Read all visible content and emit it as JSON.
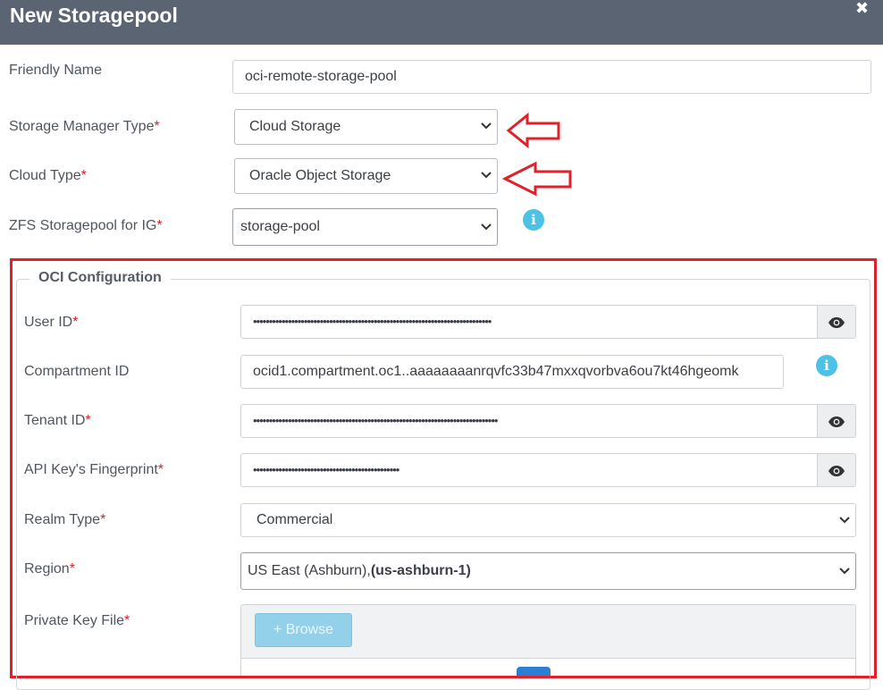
{
  "dialog": {
    "title": "New Storagepool",
    "close_icon": "✖"
  },
  "form": {
    "friendly_name": {
      "label": "Friendly Name",
      "value": "oci-remote-storage-pool"
    },
    "storage_manager_type": {
      "label": "Storage Manager Type",
      "required": "*",
      "value": "Cloud Storage"
    },
    "cloud_type": {
      "label": "Cloud Type",
      "required": "*",
      "value": "Oracle Object Storage"
    },
    "zfs_storagepool": {
      "label": "ZFS Storagepool for IG",
      "required": "*",
      "value": "storage-pool"
    }
  },
  "oci": {
    "legend": "OCI Configuration",
    "user_id": {
      "label": "User ID",
      "required": "*",
      "value": "•••••••••••••••••••••••••••••••••••••••••••••••••••••••••••••••••••••••••••"
    },
    "compartment_id": {
      "label": "Compartment ID",
      "value": "ocid1.compartment.oc1..aaaaaaaanrqvfc33b47mxxqvorbva6ou7kt46hgeomk"
    },
    "tenant_id": {
      "label": "Tenant ID",
      "required": "*",
      "value": "•••••••••••••••••••••••••••••••••••••••••••••••••••••••••••••••••••••••••••••"
    },
    "fingerprint": {
      "label": "API Key's Fingerprint",
      "required": "*",
      "value": "••••••••••••••••••••••••••••••••••••••••••••••"
    },
    "realm_type": {
      "label": "Realm Type",
      "required": "*",
      "value": "Commercial"
    },
    "region": {
      "label": "Region",
      "required": "*",
      "value_prefix": "US East (Ashburn),",
      "value_bold": "(us-ashburn-1)"
    },
    "private_key": {
      "label": "Private Key File",
      "required": "*",
      "browse_label": "Browse",
      "browse_icon": "+"
    }
  },
  "icons": {
    "info": "i",
    "eye": "eye-icon",
    "chevron": "chevron-down-icon"
  },
  "colors": {
    "header_bg": "#5b6472",
    "required": "#d2232a",
    "annotation_red": "#e0202a",
    "info_blue": "#4ec1e6",
    "browse_bg": "#93d1ea"
  }
}
